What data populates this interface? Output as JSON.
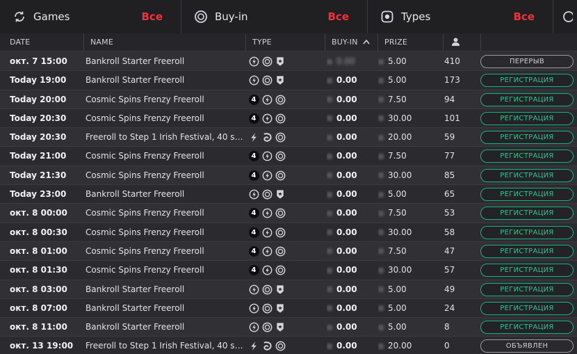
{
  "filters": [
    {
      "label": "Games",
      "value": "Все",
      "icon": "refresh-icon"
    },
    {
      "label": "Buy-in",
      "value": "Все",
      "icon": "chip-icon"
    },
    {
      "label": "Types",
      "value": "Все",
      "icon": "target-icon"
    }
  ],
  "header": {
    "date": "DATE",
    "name": "NAME",
    "type": "TYPE",
    "buyin": "BUY-IN",
    "prize": "PRIZE"
  },
  "rows": [
    {
      "date": "окт. 7 15:00",
      "name": "Bankroll Starter Freeroll",
      "types": [
        "bolt",
        "chip",
        "shield"
      ],
      "buyin": "0.00",
      "buyin_blurred": true,
      "prize": "5.00",
      "players": "410",
      "status": "ПЕРЕРЫВ",
      "status_kind": "grey"
    },
    {
      "date": "Today 19:00",
      "name": "Bankroll Starter Freeroll",
      "types": [
        "bolt",
        "chip",
        "shield"
      ],
      "buyin": "0.00",
      "prize": "5.00",
      "players": "173",
      "status": "РЕГИСТРАЦИЯ",
      "status_kind": "reg"
    },
    {
      "date": "Today 20:00",
      "name": "Cosmic Spins Frenzy Freeroll",
      "types": [
        "four",
        "bolt",
        "chip"
      ],
      "buyin": "0.00",
      "prize": "7.50",
      "players": "94",
      "status": "РЕГИСТРАЦИЯ",
      "status_kind": "reg"
    },
    {
      "date": "Today 20:30",
      "name": "Cosmic Spins Frenzy Freeroll",
      "types": [
        "four",
        "bolt",
        "chip"
      ],
      "buyin": "0.00",
      "prize": "30.00",
      "players": "101",
      "status": "РЕГИСТРАЦИЯ",
      "status_kind": "reg"
    },
    {
      "date": "Today 20:30",
      "name": "Freeroll to Step 1 Irish Festival, 40 seats ...",
      "types": [
        "flash",
        "swirl",
        "chip"
      ],
      "buyin": "0.00",
      "prize": "20.00",
      "players": "59",
      "status": "РЕГИСТРАЦИЯ",
      "status_kind": "reg"
    },
    {
      "date": "Today 21:00",
      "name": "Cosmic Spins Frenzy Freeroll",
      "types": [
        "four",
        "bolt",
        "chip"
      ],
      "buyin": "0.00",
      "prize": "7.50",
      "players": "77",
      "status": "РЕГИСТРАЦИЯ",
      "status_kind": "reg"
    },
    {
      "date": "Today 21:30",
      "name": "Cosmic Spins Frenzy Freeroll",
      "types": [
        "four",
        "bolt",
        "chip"
      ],
      "buyin": "0.00",
      "prize": "30.00",
      "players": "85",
      "status": "РЕГИСТРАЦИЯ",
      "status_kind": "reg"
    },
    {
      "date": "Today 23:00",
      "name": "Bankroll Starter Freeroll",
      "types": [
        "bolt",
        "chip",
        "shield"
      ],
      "buyin": "0.00",
      "prize": "5.00",
      "players": "65",
      "status": "РЕГИСТРАЦИЯ",
      "status_kind": "reg"
    },
    {
      "date": "окт. 8 00:00",
      "name": "Cosmic Spins Frenzy Freeroll",
      "types": [
        "four",
        "bolt",
        "chip"
      ],
      "buyin": "0.00",
      "prize": "7.50",
      "players": "53",
      "status": "РЕГИСТРАЦИЯ",
      "status_kind": "reg"
    },
    {
      "date": "окт. 8 00:30",
      "name": "Cosmic Spins Frenzy Freeroll",
      "types": [
        "four",
        "bolt",
        "chip"
      ],
      "buyin": "0.00",
      "prize": "30.00",
      "players": "58",
      "status": "РЕГИСТРАЦИЯ",
      "status_kind": "reg"
    },
    {
      "date": "окт. 8 01:00",
      "name": "Cosmic Spins Frenzy Freeroll",
      "types": [
        "four",
        "bolt",
        "chip"
      ],
      "buyin": "0.00",
      "prize": "7.50",
      "players": "47",
      "status": "РЕГИСТРАЦИЯ",
      "status_kind": "reg"
    },
    {
      "date": "окт. 8 01:30",
      "name": "Cosmic Spins Frenzy Freeroll",
      "types": [
        "four",
        "bolt",
        "chip"
      ],
      "buyin": "0.00",
      "prize": "30.00",
      "players": "57",
      "status": "РЕГИСТРАЦИЯ",
      "status_kind": "reg"
    },
    {
      "date": "окт. 8 03:00",
      "name": "Bankroll Starter Freeroll",
      "types": [
        "bolt",
        "chip",
        "shield"
      ],
      "buyin": "0.00",
      "prize": "5.00",
      "players": "49",
      "status": "РЕГИСТРАЦИЯ",
      "status_kind": "reg"
    },
    {
      "date": "окт. 8 07:00",
      "name": "Bankroll Starter Freeroll",
      "types": [
        "bolt",
        "chip",
        "shield"
      ],
      "buyin": "0.00",
      "prize": "5.00",
      "players": "24",
      "status": "РЕГИСТРАЦИЯ",
      "status_kind": "reg"
    },
    {
      "date": "окт. 8 11:00",
      "name": "Bankroll Starter Freeroll",
      "types": [
        "bolt",
        "chip",
        "shield"
      ],
      "buyin": "0.00",
      "prize": "5.00",
      "players": "8",
      "status": "РЕГИСТРАЦИЯ",
      "status_kind": "reg"
    },
    {
      "date": "окт. 13 19:00",
      "name": "Freeroll to Step 1 Irish Festival, 40 seats ...",
      "types": [
        "flash",
        "swirl",
        "chip"
      ],
      "buyin": "0.00",
      "prize": "20.00",
      "players": "0",
      "status": "ОБЪЯВЛЕН",
      "status_kind": "grey"
    }
  ],
  "colors": {
    "accent_red": "#f0323c",
    "reg_green": "#28c98b"
  }
}
